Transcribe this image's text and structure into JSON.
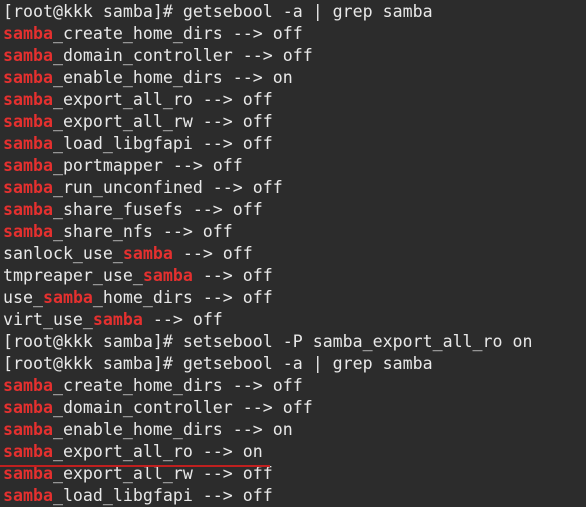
{
  "colors": {
    "background": "#2c2c2c",
    "text": "#e8e8e8",
    "highlight": "#e5302f",
    "annotation_underline": "#c0201f"
  },
  "lines": [
    [
      {
        "t": "[root@kkk samba]# getsebool -a | grep samba"
      }
    ],
    [
      {
        "t": "samba",
        "hl": true
      },
      {
        "t": "_create_home_dirs --> off"
      }
    ],
    [
      {
        "t": "samba",
        "hl": true
      },
      {
        "t": "_domain_controller --> off"
      }
    ],
    [
      {
        "t": "samba",
        "hl": true
      },
      {
        "t": "_enable_home_dirs --> on"
      }
    ],
    [
      {
        "t": "samba",
        "hl": true
      },
      {
        "t": "_export_all_ro --> off"
      }
    ],
    [
      {
        "t": "samba",
        "hl": true
      },
      {
        "t": "_export_all_rw --> off"
      }
    ],
    [
      {
        "t": "samba",
        "hl": true
      },
      {
        "t": "_load_libgfapi --> off"
      }
    ],
    [
      {
        "t": "samba",
        "hl": true
      },
      {
        "t": "_portmapper --> off"
      }
    ],
    [
      {
        "t": "samba",
        "hl": true
      },
      {
        "t": "_run_unconfined --> off"
      }
    ],
    [
      {
        "t": "samba",
        "hl": true
      },
      {
        "t": "_share_fusefs --> off"
      }
    ],
    [
      {
        "t": "samba",
        "hl": true
      },
      {
        "t": "_share_nfs --> off"
      }
    ],
    [
      {
        "t": "sanlock_use_"
      },
      {
        "t": "samba",
        "hl": true
      },
      {
        "t": " --> off"
      }
    ],
    [
      {
        "t": "tmpreaper_use_"
      },
      {
        "t": "samba",
        "hl": true
      },
      {
        "t": " --> off"
      }
    ],
    [
      {
        "t": "use_"
      },
      {
        "t": "samba",
        "hl": true
      },
      {
        "t": "_home_dirs --> off"
      }
    ],
    [
      {
        "t": "virt_use_"
      },
      {
        "t": "samba",
        "hl": true
      },
      {
        "t": " --> off"
      }
    ],
    [
      {
        "t": "[root@kkk samba]# setsebool -P samba_export_all_ro on"
      }
    ],
    [
      {
        "t": "[root@kkk samba]# getsebool -a | grep samba"
      }
    ],
    [
      {
        "t": "samba",
        "hl": true
      },
      {
        "t": "_create_home_dirs --> off"
      }
    ],
    [
      {
        "t": "samba",
        "hl": true
      },
      {
        "t": "_domain_controller --> off"
      }
    ],
    [
      {
        "t": "samba",
        "hl": true
      },
      {
        "t": "_enable_home_dirs --> on"
      }
    ],
    [
      {
        "t": "samba",
        "hl": true
      },
      {
        "t": "_export_all_ro --> on"
      }
    ],
    [
      {
        "t": "samba",
        "hl": true
      },
      {
        "t": "_export_all_rw --> off"
      }
    ],
    [
      {
        "t": "samba",
        "hl": true
      },
      {
        "t": "_load_libgfapi --> off"
      }
    ]
  ]
}
